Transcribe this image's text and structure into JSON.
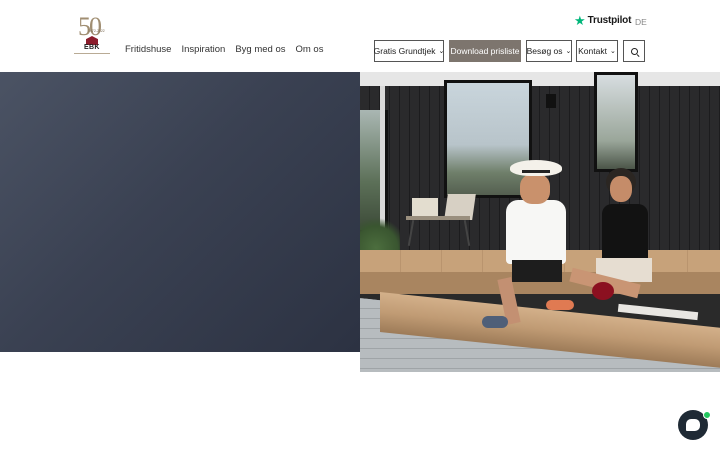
{
  "header": {
    "logo": {
      "number": "50",
      "years_text": "1972-2022",
      "brand": "EBK"
    },
    "nav": [
      {
        "label": "Fritidshuse"
      },
      {
        "label": "Inspiration"
      },
      {
        "label": "Byg med os"
      },
      {
        "label": "Om os"
      }
    ],
    "trustpilot": {
      "label": "Trustpilot",
      "star_color": "#00b67a"
    },
    "language": "DE",
    "buttons": {
      "catalog": "Gratis Grundtjek",
      "download": "Download prisliste",
      "visit": "Besøg os",
      "contact": "Kontakt"
    }
  },
  "hero": {
    "left_color": "#3a4152",
    "image_alt": "Couple sitting on wooden deck in front of black holiday house"
  },
  "chat": {
    "status_color": "#22c55e"
  },
  "colors": {
    "accent_button": "#7d756e",
    "brand_red": "#8b1d2c"
  }
}
